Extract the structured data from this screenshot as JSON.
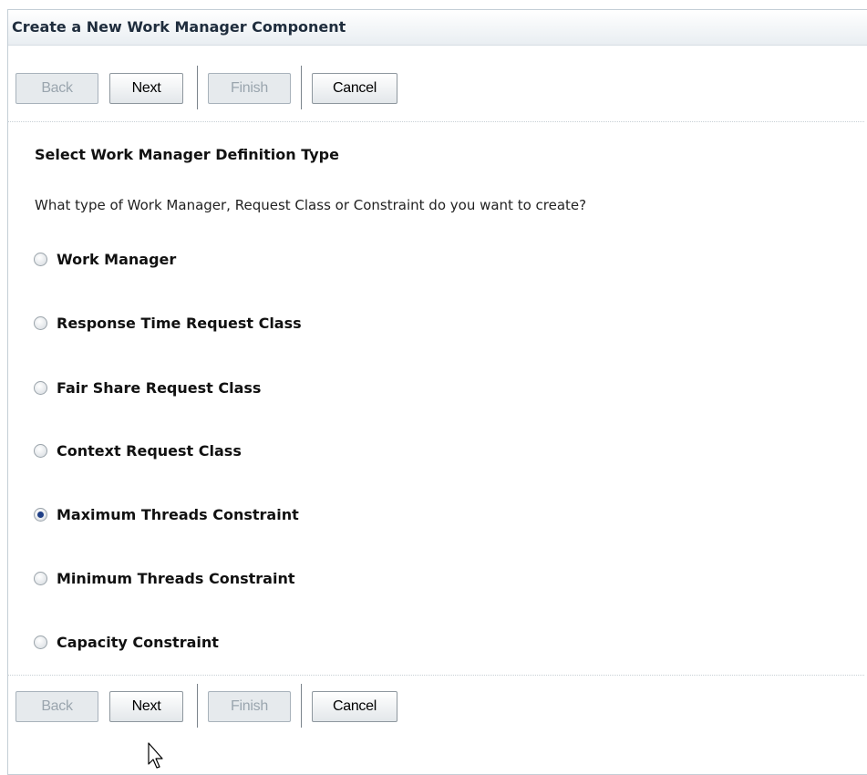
{
  "dialog": {
    "title": "Create a New Work Manager Component"
  },
  "toolbar": {
    "back_label": "Back",
    "next_label": "Next",
    "finish_label": "Finish",
    "cancel_label": "Cancel"
  },
  "section": {
    "title": "Select Work Manager Definition Type",
    "question": "What type of Work Manager, Request Class or Constraint do you want to create?"
  },
  "options": [
    {
      "label": "Work Manager",
      "checked": false
    },
    {
      "label": "Response Time Request Class",
      "checked": false
    },
    {
      "label": "Fair Share Request Class",
      "checked": false
    },
    {
      "label": "Context Request Class",
      "checked": false
    },
    {
      "label": "Maximum Threads Constraint",
      "checked": true
    },
    {
      "label": "Minimum Threads Constraint",
      "checked": false
    },
    {
      "label": "Capacity Constraint",
      "checked": false
    }
  ],
  "selected_option": "Maximum Threads Constraint",
  "icons": {
    "cursor": "mouse-pointer-icon"
  },
  "colors": {
    "title_bar": "#e9eef2",
    "disabled_button": "#e6eaed",
    "radio_dot": "#1f3f86"
  }
}
